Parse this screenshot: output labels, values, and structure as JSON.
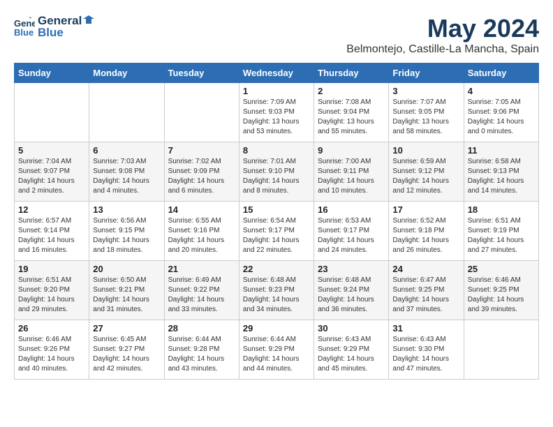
{
  "header": {
    "logo_line1": "General",
    "logo_line2": "Blue",
    "month": "May 2024",
    "location": "Belmontejo, Castille-La Mancha, Spain"
  },
  "days_of_week": [
    "Sunday",
    "Monday",
    "Tuesday",
    "Wednesday",
    "Thursday",
    "Friday",
    "Saturday"
  ],
  "weeks": [
    [
      {
        "day": "",
        "info": ""
      },
      {
        "day": "",
        "info": ""
      },
      {
        "day": "",
        "info": ""
      },
      {
        "day": "1",
        "info": "Sunrise: 7:09 AM\nSunset: 9:03 PM\nDaylight: 13 hours\nand 53 minutes."
      },
      {
        "day": "2",
        "info": "Sunrise: 7:08 AM\nSunset: 9:04 PM\nDaylight: 13 hours\nand 55 minutes."
      },
      {
        "day": "3",
        "info": "Sunrise: 7:07 AM\nSunset: 9:05 PM\nDaylight: 13 hours\nand 58 minutes."
      },
      {
        "day": "4",
        "info": "Sunrise: 7:05 AM\nSunset: 9:06 PM\nDaylight: 14 hours\nand 0 minutes."
      }
    ],
    [
      {
        "day": "5",
        "info": "Sunrise: 7:04 AM\nSunset: 9:07 PM\nDaylight: 14 hours\nand 2 minutes."
      },
      {
        "day": "6",
        "info": "Sunrise: 7:03 AM\nSunset: 9:08 PM\nDaylight: 14 hours\nand 4 minutes."
      },
      {
        "day": "7",
        "info": "Sunrise: 7:02 AM\nSunset: 9:09 PM\nDaylight: 14 hours\nand 6 minutes."
      },
      {
        "day": "8",
        "info": "Sunrise: 7:01 AM\nSunset: 9:10 PM\nDaylight: 14 hours\nand 8 minutes."
      },
      {
        "day": "9",
        "info": "Sunrise: 7:00 AM\nSunset: 9:11 PM\nDaylight: 14 hours\nand 10 minutes."
      },
      {
        "day": "10",
        "info": "Sunrise: 6:59 AM\nSunset: 9:12 PM\nDaylight: 14 hours\nand 12 minutes."
      },
      {
        "day": "11",
        "info": "Sunrise: 6:58 AM\nSunset: 9:13 PM\nDaylight: 14 hours\nand 14 minutes."
      }
    ],
    [
      {
        "day": "12",
        "info": "Sunrise: 6:57 AM\nSunset: 9:14 PM\nDaylight: 14 hours\nand 16 minutes."
      },
      {
        "day": "13",
        "info": "Sunrise: 6:56 AM\nSunset: 9:15 PM\nDaylight: 14 hours\nand 18 minutes."
      },
      {
        "day": "14",
        "info": "Sunrise: 6:55 AM\nSunset: 9:16 PM\nDaylight: 14 hours\nand 20 minutes."
      },
      {
        "day": "15",
        "info": "Sunrise: 6:54 AM\nSunset: 9:17 PM\nDaylight: 14 hours\nand 22 minutes."
      },
      {
        "day": "16",
        "info": "Sunrise: 6:53 AM\nSunset: 9:17 PM\nDaylight: 14 hours\nand 24 minutes."
      },
      {
        "day": "17",
        "info": "Sunrise: 6:52 AM\nSunset: 9:18 PM\nDaylight: 14 hours\nand 26 minutes."
      },
      {
        "day": "18",
        "info": "Sunrise: 6:51 AM\nSunset: 9:19 PM\nDaylight: 14 hours\nand 27 minutes."
      }
    ],
    [
      {
        "day": "19",
        "info": "Sunrise: 6:51 AM\nSunset: 9:20 PM\nDaylight: 14 hours\nand 29 minutes."
      },
      {
        "day": "20",
        "info": "Sunrise: 6:50 AM\nSunset: 9:21 PM\nDaylight: 14 hours\nand 31 minutes."
      },
      {
        "day": "21",
        "info": "Sunrise: 6:49 AM\nSunset: 9:22 PM\nDaylight: 14 hours\nand 33 minutes."
      },
      {
        "day": "22",
        "info": "Sunrise: 6:48 AM\nSunset: 9:23 PM\nDaylight: 14 hours\nand 34 minutes."
      },
      {
        "day": "23",
        "info": "Sunrise: 6:48 AM\nSunset: 9:24 PM\nDaylight: 14 hours\nand 36 minutes."
      },
      {
        "day": "24",
        "info": "Sunrise: 6:47 AM\nSunset: 9:25 PM\nDaylight: 14 hours\nand 37 minutes."
      },
      {
        "day": "25",
        "info": "Sunrise: 6:46 AM\nSunset: 9:25 PM\nDaylight: 14 hours\nand 39 minutes."
      }
    ],
    [
      {
        "day": "26",
        "info": "Sunrise: 6:46 AM\nSunset: 9:26 PM\nDaylight: 14 hours\nand 40 minutes."
      },
      {
        "day": "27",
        "info": "Sunrise: 6:45 AM\nSunset: 9:27 PM\nDaylight: 14 hours\nand 42 minutes."
      },
      {
        "day": "28",
        "info": "Sunrise: 6:44 AM\nSunset: 9:28 PM\nDaylight: 14 hours\nand 43 minutes."
      },
      {
        "day": "29",
        "info": "Sunrise: 6:44 AM\nSunset: 9:29 PM\nDaylight: 14 hours\nand 44 minutes."
      },
      {
        "day": "30",
        "info": "Sunrise: 6:43 AM\nSunset: 9:29 PM\nDaylight: 14 hours\nand 45 minutes."
      },
      {
        "day": "31",
        "info": "Sunrise: 6:43 AM\nSunset: 9:30 PM\nDaylight: 14 hours\nand 47 minutes."
      },
      {
        "day": "",
        "info": ""
      }
    ]
  ]
}
